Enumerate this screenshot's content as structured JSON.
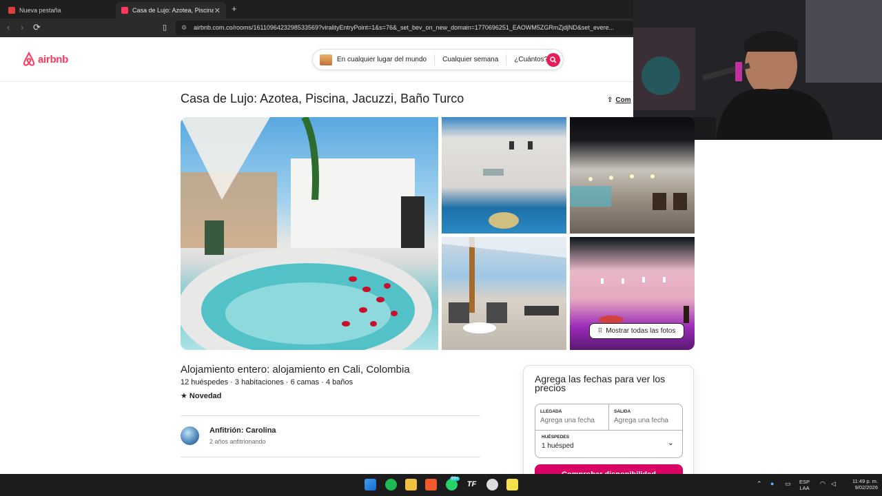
{
  "browser": {
    "tabs": [
      {
        "label": "Nueva pestaña"
      },
      {
        "label": "Casa de Lujo: Azotea, Piscina, Ja"
      }
    ],
    "url": "airbnb.com.co/rooms/1611096423298533569?viralityEntryPoint=1&s=76&_set_bev_on_new_domain=1770696251_EAOWM5ZGRmZjdjND&set_evere..."
  },
  "header": {
    "logo_text": "airbnb",
    "search": {
      "where": "En cualquier lugar del mundo",
      "when": "Cualquier semana",
      "who": "¿Cuántos?"
    }
  },
  "listing": {
    "title": "Casa de Lujo: Azotea, Piscina, Jacuzzi, Baño Turco",
    "share_label": "Com",
    "show_all_photos": "Mostrar todas las fotos",
    "type_location": "Alojamiento entero: alojamiento en Cali, Colombia",
    "details": "12 huéspedes · 3 habitaciones · 6 camas · 4 baños",
    "rating": "★ Novedad",
    "host": {
      "name": "Anfitrión: Carolina",
      "experience": "2 años anfitrionando"
    }
  },
  "booking": {
    "title": "Agrega las fechas para ver los precios",
    "checkin_label": "LLEGADA",
    "checkin_placeholder": "Agrega una fecha",
    "checkout_label": "SALIDA",
    "checkout_placeholder": "Agrega una fecha",
    "guests_label": "HUÉSPEDES",
    "guests_value": "1 huésped",
    "button": "Comprobar disponibilidad"
  },
  "taskbar": {
    "badge": "99+",
    "lang": "ESP",
    "lang2": "LAA",
    "time": "11:49 p. m.",
    "date": "9/02/2026"
  },
  "colors": {
    "brand": "#ff385c",
    "cta": "#d70466"
  }
}
